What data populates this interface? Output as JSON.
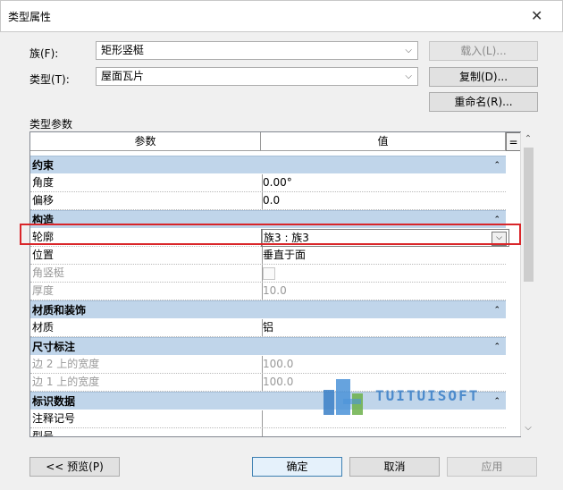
{
  "dialog": {
    "title": "类型属性",
    "close_glyph": "✕"
  },
  "family": {
    "label": "族(F):",
    "value": "矩形竖梃",
    "load_button": "载入(L)..."
  },
  "type": {
    "label": "类型(T):",
    "value": "屋面瓦片",
    "duplicate_button": "复制(D)...",
    "rename_button": "重命名(R)..."
  },
  "type_params": {
    "section_label": "类型参数",
    "col_param": "参数",
    "col_value": "值",
    "col_toggle": "=",
    "groups": [
      {
        "name": "约束",
        "rows": [
          {
            "param": "角度",
            "value": "0.00°"
          },
          {
            "param": "偏移",
            "value": "0.0"
          }
        ]
      },
      {
        "name": "构造",
        "rows": [
          {
            "param": "轮廓",
            "value": "族3 : 族3"
          },
          {
            "param": "位置",
            "value": "垂直于面"
          },
          {
            "param": "角竖梃",
            "value": ""
          },
          {
            "param": "厚度",
            "value": "10.0"
          }
        ]
      },
      {
        "name": "材质和装饰",
        "rows": [
          {
            "param": "材质",
            "value": "铝"
          }
        ]
      },
      {
        "name": "尺寸标注",
        "rows": [
          {
            "param": "边 2 上的宽度",
            "value": "100.0"
          },
          {
            "param": "边 1 上的宽度",
            "value": "100.0"
          }
        ]
      },
      {
        "name": "标识数据",
        "rows": [
          {
            "param": "注释记号",
            "value": ""
          },
          {
            "param": "型号",
            "value": ""
          }
        ]
      }
    ]
  },
  "watermark": {
    "text": "TUITUISOFT"
  },
  "footer": {
    "preview_button": "<< 预览(P)",
    "ok_button": "确定",
    "cancel_button": "取消",
    "apply_button": "应用"
  },
  "colors": {
    "group_header_bg": "#c0d5ea",
    "highlight_border": "#d9262a",
    "dialog_bg": "#f0f0f0"
  }
}
